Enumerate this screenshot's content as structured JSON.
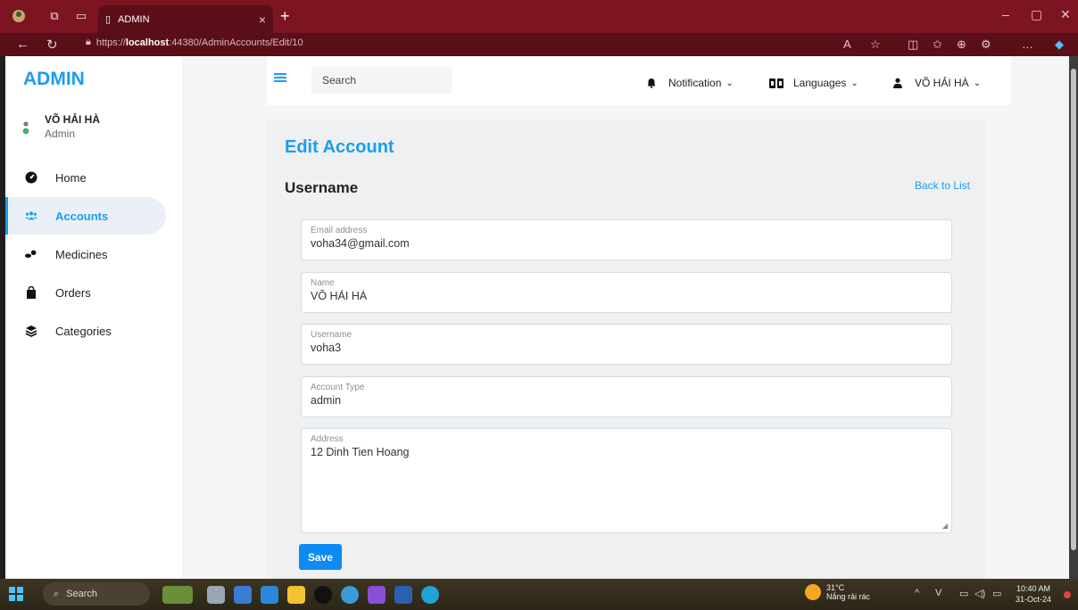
{
  "browser": {
    "tab_title": "ADMIN",
    "tab_close": "×",
    "new_tab": "+",
    "url_prefix": "https://",
    "url_host": "localhost",
    "url_rest": ":44380/AdminAccounts/Edit/10"
  },
  "sidebar": {
    "brand": "ADMIN",
    "user_name": "VÕ HẢI HÀ",
    "user_role": "Admin",
    "items": [
      {
        "label": "Home",
        "icon": "dashboard-icon",
        "active": false
      },
      {
        "label": "Accounts",
        "icon": "users-icon",
        "active": true
      },
      {
        "label": "Medicines",
        "icon": "pills-icon",
        "active": false
      },
      {
        "label": "Orders",
        "icon": "bag-icon",
        "active": false
      },
      {
        "label": "Categories",
        "icon": "layers-icon",
        "active": false
      }
    ]
  },
  "topbar": {
    "search_placeholder": "Search",
    "notification_label": "Notification",
    "languages_label": "Languages",
    "user_label": "VÕ HẢI HÀ"
  },
  "form": {
    "title": "Edit Account",
    "section": "Username",
    "back_link": "Back to List",
    "fields": {
      "email": {
        "label": "Email address",
        "value": "voha34@gmail.com"
      },
      "name": {
        "label": "Name",
        "value": "VÕ HẢI HÀ"
      },
      "username": {
        "label": "Username",
        "value": "voha3"
      },
      "account_type": {
        "label": "Account Type",
        "value": "admin"
      },
      "address": {
        "label": "Address",
        "value": "12 Dinh Tien Hoang"
      }
    },
    "save_label": "Save"
  },
  "taskbar": {
    "search_label": "Search",
    "weather_temp": "31°C",
    "weather_desc": "Nắng rải rác",
    "time": "10:40 AM",
    "date": "31-Oct-24"
  },
  "colors": {
    "accent": "#1b9df0",
    "save_button": "#0d8bf2",
    "titlebar": "#7c1421"
  }
}
